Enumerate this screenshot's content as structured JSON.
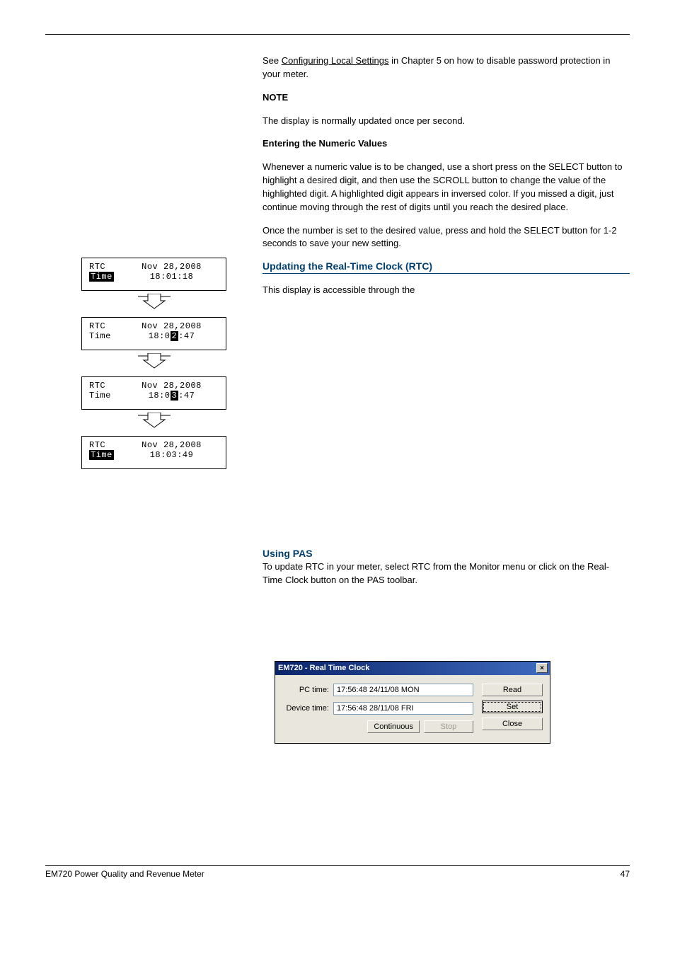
{
  "top": {
    "p1_prefix": "See ",
    "p1_link": "Configuring Local Settings",
    "p1_rest": " in Chapter 5 on how to disable password protection in your meter.",
    "p2": "The display is normally updated once per second.",
    "p3_title": "Entering the Numeric Values",
    "p3_body": "Whenever a numeric value is to be changed, use a short press on the SELECT button to highlight a desired digit, and then use the SCROLL button to change the value of the highlighted digit. A highlighted digit appears in inversed color. If you missed a digit, just continue moving through the rest of digits until you reach the desired place.",
    "p3_last": "Once the number is set to the desired value, press and hold the SELECT button for 1-2 seconds to save your new setting."
  },
  "rtc_section": {
    "heading": "Updating the Real-Time Clock (RTC)",
    "line1": "This display is accessible through the "
  },
  "lcd": [
    {
      "l1": "RTC",
      "r1": "Nov 28,2008",
      "l2_inv": "Time",
      "r2": "18:01:18"
    },
    {
      "l1": "RTC",
      "r1": "Nov 28,2008",
      "l2": "Time",
      "r2": "18:02:47",
      "hl": true
    },
    {
      "l1": "RTC",
      "r1": "Nov 28,2008",
      "l2": "Time",
      "r2": "18:03:47",
      "hl": true
    },
    {
      "l1": "RTC",
      "r1": "Nov 28,2008",
      "l2_inv": "Time",
      "r2": "18:03:49"
    }
  ],
  "pas": {
    "heading": "Using PAS",
    "p": "To update RTC in your meter, select RTC from the Monitor menu or click on the Real-Time Clock button on the PAS toolbar."
  },
  "dialog": {
    "title": "EM720 - Real Time Clock",
    "pc_label": "PC time:",
    "pc_value": "17:56:48 24/11/08 MON",
    "dev_label": "Device time:",
    "dev_value": "17:56:48 28/11/08 FRI",
    "continuous": "Continuous",
    "stop": "Stop",
    "read": "Read",
    "set": "Set",
    "close": "Close"
  },
  "footer": {
    "left": "EM720 Power Quality and Revenue Meter",
    "right": "47"
  }
}
